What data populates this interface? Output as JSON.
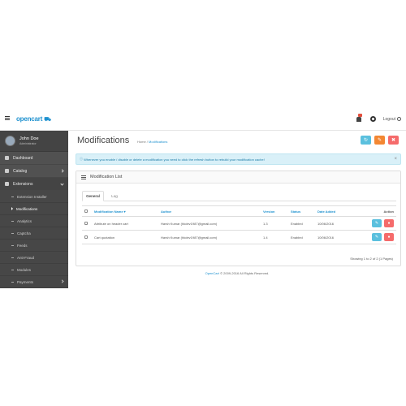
{
  "header": {
    "logo_text": "opencart",
    "logo_icon": "cart-icon",
    "logout_label": "Logout",
    "accent_color": "#1e91cf"
  },
  "user": {
    "name": "John Doe",
    "role": "Administrator"
  },
  "sidebar": {
    "items": [
      {
        "label": "Dashboard",
        "icon": "dashboard-icon"
      },
      {
        "label": "Catalog",
        "icon": "tags-icon"
      },
      {
        "label": "Extensions",
        "icon": "puzzle-icon"
      }
    ],
    "subitems": [
      {
        "label": "Extension Installer"
      },
      {
        "label": "Modifications"
      },
      {
        "label": "Analytics"
      },
      {
        "label": "Captcha"
      },
      {
        "label": "Feeds"
      },
      {
        "label": "Anti-Fraud"
      },
      {
        "label": "Modules"
      },
      {
        "label": "Payments"
      }
    ]
  },
  "page": {
    "title": "Modifications",
    "breadcrumb_home": "Home",
    "breadcrumb_sep": "/",
    "breadcrumb_current": "Modifications"
  },
  "buttons": {
    "refresh_icon": "refresh-icon",
    "clear_icon": "eraser-icon",
    "delete_icon": "trash-icon"
  },
  "alert": {
    "text": "Whenever you enable / disable or delete a modification you need to click the refresh button to rebuild your modification cache!",
    "close": "×"
  },
  "panel": {
    "title": "Modification List",
    "tabs": [
      {
        "label": "General"
      },
      {
        "label": "Log"
      }
    ],
    "columns": {
      "name": "Modification Name ▾",
      "author": "Author",
      "version": "Version",
      "status": "Status",
      "date": "Date Added",
      "action": "Action"
    },
    "rows": [
      {
        "name": "Attribute on header cart",
        "author": "Harsh Kumar (hkdev1987@gmail.com)",
        "version": "1.3",
        "status": "Enabled",
        "date": "10/06/2016"
      },
      {
        "name": "Cart quotation",
        "author": "Harsh Kumar (hkdev1987@gmail.com)",
        "version": "1.4",
        "status": "Enabled",
        "date": "10/06/2016"
      }
    ],
    "pager_text": "Showing 1 to 2 of 2 (1 Pages)"
  },
  "footer": {
    "link": "OpenCart",
    "text": " © 2009-2016 All Rights Reserved."
  }
}
